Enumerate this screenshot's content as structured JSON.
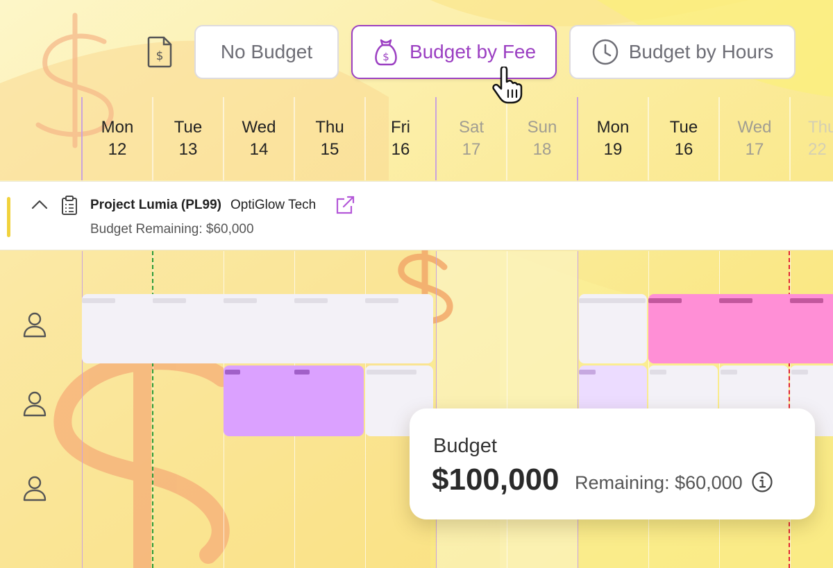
{
  "toolbar": {
    "invoice_icon": "invoice-dollar-icon",
    "options": [
      {
        "label": "No Budget",
        "icon": null,
        "active": false
      },
      {
        "label": "Budget by Fee",
        "icon": "money-bag-icon",
        "active": true
      },
      {
        "label": "Budget by Hours",
        "icon": "clock-icon",
        "active": false
      }
    ]
  },
  "calendar": {
    "days": [
      {
        "name": "Mon",
        "date": "12",
        "state": "normal"
      },
      {
        "name": "Tue",
        "date": "13",
        "state": "normal"
      },
      {
        "name": "Wed",
        "date": "14",
        "state": "normal"
      },
      {
        "name": "Thu",
        "date": "15",
        "state": "normal"
      },
      {
        "name": "Fri",
        "date": "16",
        "state": "normal"
      },
      {
        "name": "Sat",
        "date": "17",
        "state": "muted"
      },
      {
        "name": "Sun",
        "date": "18",
        "state": "muted"
      },
      {
        "name": "Mon",
        "date": "19",
        "state": "normal"
      },
      {
        "name": "Tue",
        "date": "16",
        "state": "normal"
      },
      {
        "name": "Wed",
        "date": "17",
        "state": "muted"
      },
      {
        "name": "Thu",
        "date": "22",
        "state": "faint"
      }
    ]
  },
  "project": {
    "title": "Project Lumia (PL99)",
    "client": "OptiGlow Tech",
    "budget_remaining": "Budget Remaining: $60,000",
    "accent_color": "#f1d23c"
  },
  "tooltip": {
    "label": "Budget",
    "amount": "$100,000",
    "remaining": "Remaining: $60,000"
  },
  "colors": {
    "accent": "#9b3fc2",
    "pink_bar": "#ff8fd6",
    "purple_bar": "#dba1ff",
    "today_line": "#2a9a3a",
    "deadline_line": "#e0242f"
  }
}
